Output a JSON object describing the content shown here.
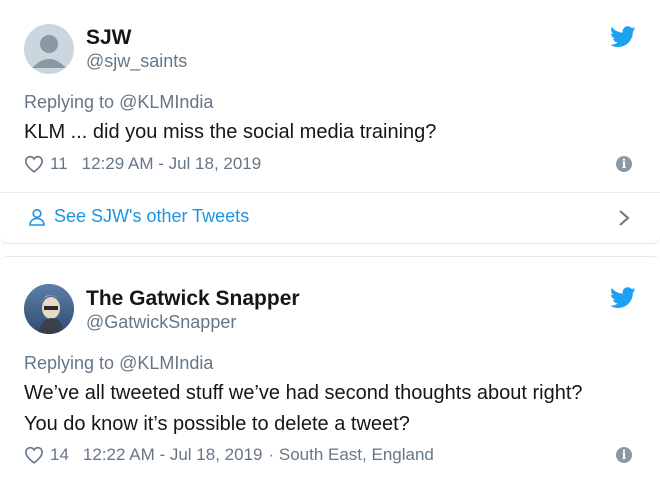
{
  "tweets": [
    {
      "name": "SJW",
      "handle": "@sjw_saints",
      "reply_prefix": "Replying to",
      "reply_handle": "@KLMIndia",
      "text_lines": [
        "KLM ... did you miss the social media training?"
      ],
      "likes": "11",
      "timestamp": "12:29 AM - Jul 18, 2019",
      "location": ""
    },
    {
      "name": "The Gatwick Snapper",
      "handle": "@GatwickSnapper",
      "reply_prefix": "Replying to",
      "reply_handle": "@KLMIndia",
      "text_lines": [
        "We’ve all tweeted stuff we’ve had second thoughts about right?",
        "You do know it’s possible to delete a tweet?"
      ],
      "likes": "14",
      "timestamp": "12:22 AM - Jul 18, 2019",
      "location": "· South East, England"
    }
  ],
  "more_tweets_label": "See SJW's other Tweets",
  "colors": {
    "twitter_blue": "#1da1f2",
    "link_blue": "#1b95e0",
    "secondary_text": "#657786",
    "primary_text": "#14171a",
    "avatar_gray": "#ccd6dd"
  },
  "icons": [
    "default-avatar-icon",
    "twitter-bird-icon",
    "heart-icon",
    "info-icon",
    "person-icon",
    "chevron-right-icon"
  ]
}
